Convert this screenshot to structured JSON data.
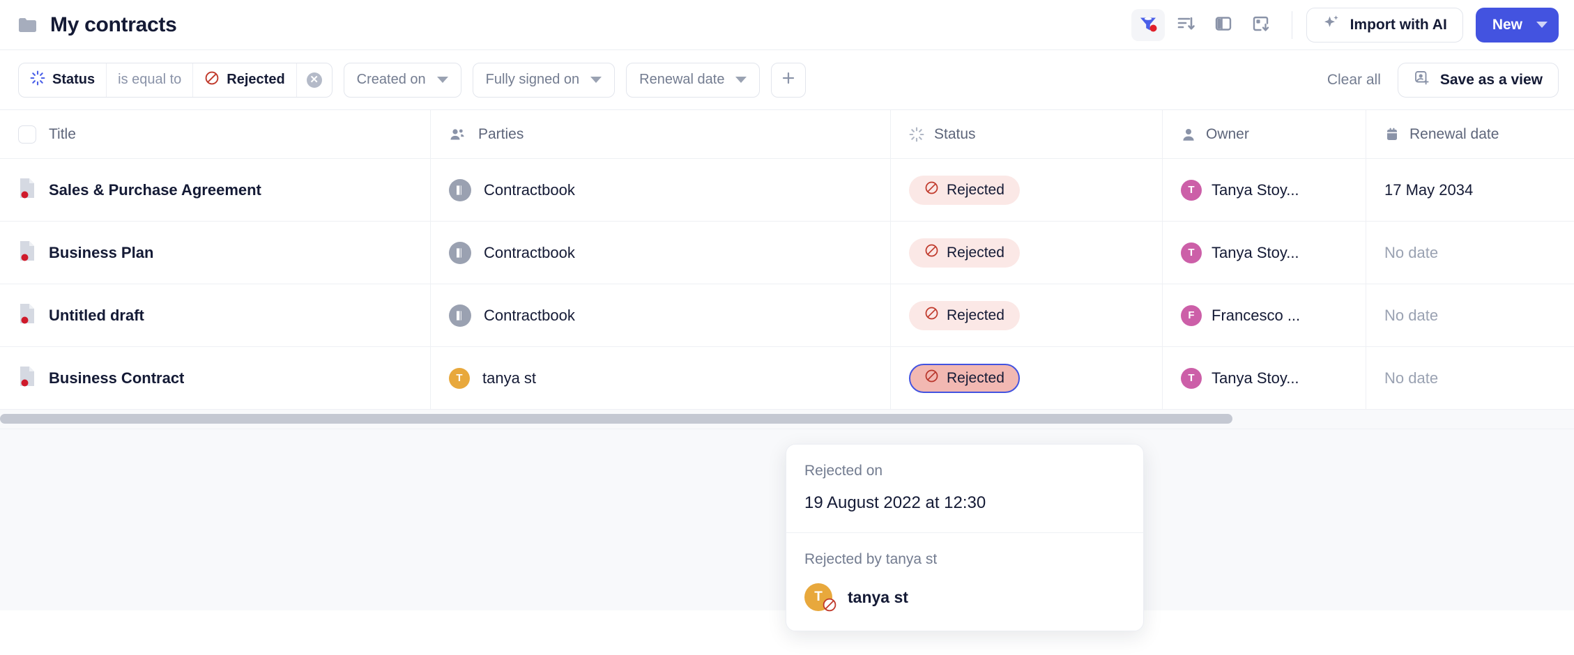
{
  "header": {
    "folder_icon": "folder-icon",
    "title": "My contracts",
    "toolbar": {
      "filter_icon": "filter-active-icon",
      "sort_icon": "sort-descending-icon",
      "columns_icon": "columns-layout-icon",
      "export_icon": "export-download-icon",
      "import_ai_label": "Import with AI",
      "import_ai_icon": "sparkle-icon",
      "new_label": "New",
      "new_caret_icon": "chevron-down-icon"
    }
  },
  "filterbar": {
    "status_filter": {
      "field_icon": "status-burst-icon",
      "field": "Status",
      "operator": "is equal to",
      "value_icon": "rejected-icon",
      "value": "Rejected",
      "clear_icon": "clear-filter-icon"
    },
    "pills": [
      {
        "label": "Created on",
        "icon": "chevron-down-icon"
      },
      {
        "label": "Fully signed on",
        "icon": "chevron-down-icon"
      },
      {
        "label": "Renewal date",
        "icon": "chevron-down-icon"
      }
    ],
    "add_filter_icon": "plus-icon",
    "clear_all_label": "Clear all",
    "save_view_label": "Save as a view",
    "save_view_icon": "save-view-icon"
  },
  "table": {
    "columns": [
      {
        "key": "title",
        "label": "Title",
        "icon": "checkbox-icon"
      },
      {
        "key": "parties",
        "label": "Parties",
        "icon": "people-icon"
      },
      {
        "key": "status",
        "label": "Status",
        "icon": "status-burst-icon"
      },
      {
        "key": "owner",
        "label": "Owner",
        "icon": "person-icon"
      },
      {
        "key": "renewal",
        "label": "Renewal date",
        "icon": "calendar-icon"
      }
    ],
    "rows": [
      {
        "title": "Sales & Purchase Agreement",
        "party": "Contractbook",
        "party_avatar_type": "contractbook",
        "party_avatar_letter": "",
        "status": "Rejected",
        "status_selected": false,
        "owner": "Tanya Stoy...",
        "owner_initial": "T",
        "renewal": "17 May 2034",
        "renewal_empty": false
      },
      {
        "title": "Business Plan",
        "party": "Contractbook",
        "party_avatar_type": "contractbook",
        "party_avatar_letter": "",
        "status": "Rejected",
        "status_selected": false,
        "owner": "Tanya Stoy...",
        "owner_initial": "T",
        "renewal": "No date",
        "renewal_empty": true
      },
      {
        "title": "Untitled draft",
        "party": "Contractbook",
        "party_avatar_type": "contractbook",
        "party_avatar_letter": "",
        "status": "Rejected",
        "status_selected": false,
        "owner": "Francesco ...",
        "owner_initial": "F",
        "renewal": "No date",
        "renewal_empty": true
      },
      {
        "title": "Business Contract",
        "party": "tanya st",
        "party_avatar_type": "letter",
        "party_avatar_letter": "T",
        "status": "Rejected",
        "status_selected": true,
        "owner": "Tanya Stoy...",
        "owner_initial": "T",
        "renewal": "No date",
        "renewal_empty": true
      }
    ]
  },
  "popover": {
    "rejected_on_label": "Rejected on",
    "rejected_on_value": "19 August 2022 at 12:30",
    "rejected_by_label": "Rejected by tanya st",
    "user_name": "tanya st",
    "user_initial": "T",
    "user_badge_icon": "rejected-icon"
  },
  "colors": {
    "accent": "#4353e0",
    "rejected_text": "#c0392b",
    "rejected_bg": "#fbe8e6",
    "rejected_bg_selected": "#f2b8b2",
    "avatar_owner": "#cc5fa8",
    "avatar_tanya": "#e8a83c",
    "title_text": "#141a35",
    "muted_text": "#737c90"
  }
}
